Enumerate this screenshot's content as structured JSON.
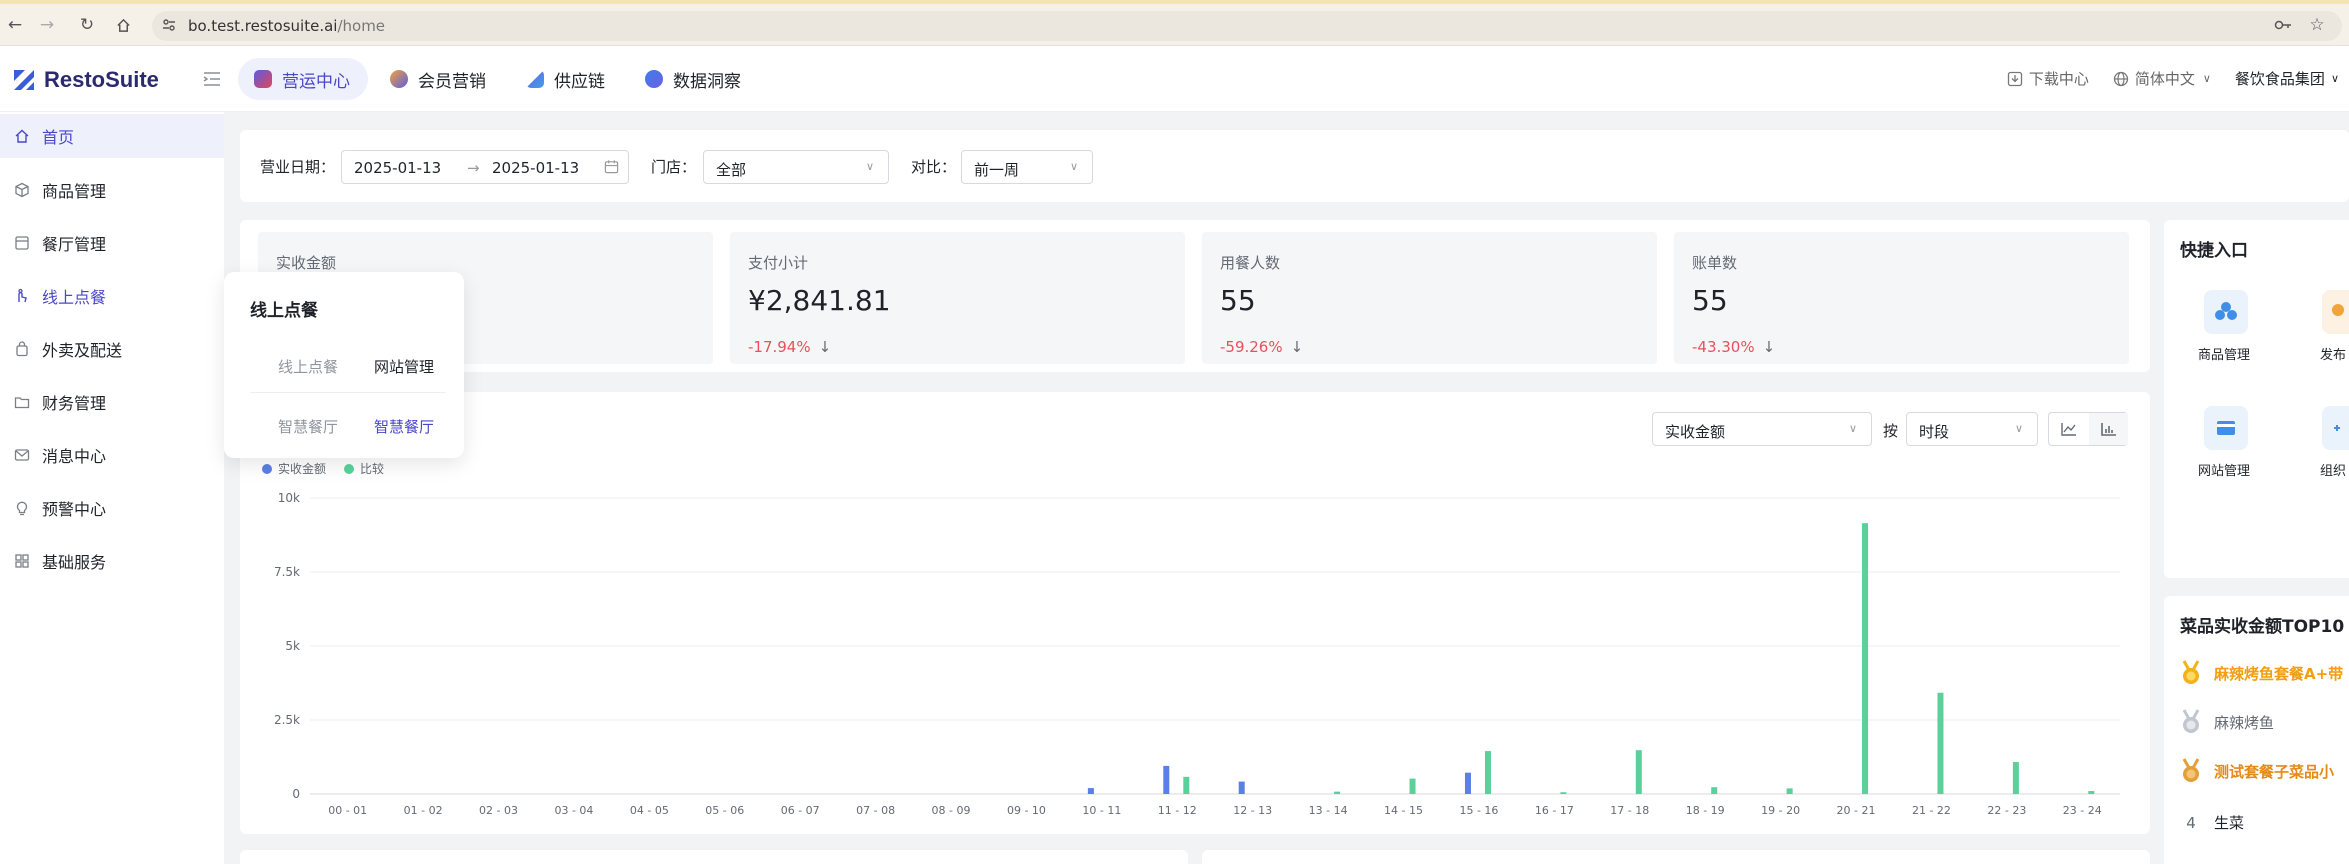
{
  "browser": {
    "url_host": "bo.test.restosuite.ai",
    "url_path": "/home"
  },
  "app": {
    "logo_text": "RestoSuite",
    "topnav": [
      {
        "label": "营运中心",
        "active": true,
        "color": "#5b5ce2"
      },
      {
        "label": "会员营销",
        "active": false,
        "color": "#f2a33a"
      },
      {
        "label": "供应链",
        "active": false,
        "color": "#6a5ee8"
      },
      {
        "label": "数据洞察",
        "active": false,
        "color": "#3f7ee8"
      }
    ],
    "header_right": {
      "download": "下载中心",
      "language": "简体中文",
      "org": "餐饮食品集团"
    }
  },
  "sidebar": {
    "items": [
      {
        "label": "首页",
        "icon": "home-icon"
      },
      {
        "label": "商品管理",
        "icon": "box-icon"
      },
      {
        "label": "餐厅管理",
        "icon": "store-icon"
      },
      {
        "label": "线上点餐",
        "icon": "hand-icon"
      },
      {
        "label": "外卖及配送",
        "icon": "bag-icon"
      },
      {
        "label": "财务管理",
        "icon": "folder-icon"
      },
      {
        "label": "消息中心",
        "icon": "mail-icon"
      },
      {
        "label": "预警中心",
        "icon": "bulb-icon"
      },
      {
        "label": "基础服务",
        "icon": "grid-icon"
      }
    ]
  },
  "popover": {
    "title": "线上点餐",
    "items": [
      {
        "label": "线上点餐",
        "style": "muted"
      },
      {
        "label": "网站管理",
        "style": "normal"
      },
      {
        "label": "智慧餐厅",
        "style": "muted"
      },
      {
        "label": "智慧餐厅",
        "style": "active"
      }
    ]
  },
  "filters": {
    "date_label": "营业日期：",
    "date_start": "2025-01-13",
    "date_end": "2025-01-13",
    "store_label": "门店：",
    "store_value": "全部",
    "compare_label": "对比：",
    "compare_value": "前一周"
  },
  "kpis": [
    {
      "label": "实收金额",
      "value": "",
      "change": ""
    },
    {
      "label": "支付小计",
      "value": "¥2,841.81",
      "change": "-17.94%"
    },
    {
      "label": "用餐人数",
      "value": "55",
      "change": "-59.26%"
    },
    {
      "label": "账单数",
      "value": "55",
      "change": "-43.30%"
    }
  ],
  "chart_controls": {
    "metric": "实收金额",
    "by_label": "按",
    "group": "时段"
  },
  "chart_data": {
    "type": "bar",
    "categories": [
      "00 - 01",
      "01 - 02",
      "02 - 03",
      "03 - 04",
      "04 - 05",
      "05 - 06",
      "06 - 07",
      "07 - 08",
      "08 - 09",
      "09 - 10",
      "10 - 11",
      "11 - 12",
      "12 - 13",
      "13 - 14",
      "14 - 15",
      "15 - 16",
      "16 - 17",
      "17 - 18",
      "18 - 19",
      "19 - 20",
      "20 - 21",
      "21 - 22",
      "22 - 23",
      "23 - 24"
    ],
    "series": [
      {
        "name": "实收金额",
        "color": "#5b7fe6",
        "values": [
          0,
          0,
          0,
          0,
          0,
          0,
          0,
          0,
          0,
          0,
          200,
          950,
          420,
          0,
          0,
          720,
          0,
          0,
          0,
          0,
          0,
          0,
          0,
          0
        ]
      },
      {
        "name": "比较",
        "color": "#5ad19b",
        "values": [
          0,
          0,
          0,
          0,
          0,
          0,
          0,
          0,
          0,
          0,
          0,
          580,
          0,
          80,
          520,
          1450,
          60,
          1480,
          230,
          190,
          9150,
          3420,
          1080,
          100
        ]
      }
    ],
    "ylim": [
      0,
      10000
    ],
    "yticks": [
      "0",
      "2.5k",
      "5k",
      "7.5k",
      "10k"
    ],
    "grid": true,
    "legend": "top-left"
  },
  "quick_entry": {
    "title": "快捷入口",
    "items": [
      {
        "label": "商品管理",
        "icon": "cubes-icon"
      },
      {
        "label": "发布",
        "icon": "release-icon"
      },
      {
        "label": "网站管理",
        "icon": "card-icon"
      },
      {
        "label": "组织",
        "icon": "org-icon"
      }
    ]
  },
  "top10": {
    "title": "菜品实收金额TOP10",
    "items": [
      {
        "rank": "1",
        "name": "麻辣烤鱼套餐A+带",
        "medal_color": "#f2b21c",
        "text_color": "#f29d12"
      },
      {
        "rank": "2",
        "name": "麻辣烤鱼",
        "medal_color": "#c2c7cf",
        "text_color": "#646a73"
      },
      {
        "rank": "3",
        "name": "测试套餐子菜品小",
        "medal_color": "#e3a03a",
        "text_color": "#e58a16"
      },
      {
        "rank": "4",
        "name": "生菜",
        "medal_color": "",
        "text_color": "#1f2329"
      }
    ]
  }
}
